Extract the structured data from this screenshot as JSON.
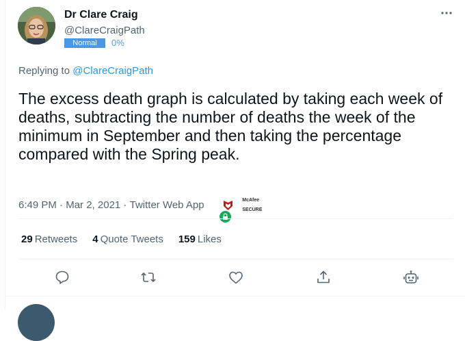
{
  "tweet": {
    "author_name": "Dr Clare Craig",
    "author_handle": "@ClareCraigPath",
    "badge_label": "Normal",
    "badge_percent": "0%",
    "replying_prefix": "Replying to ",
    "replying_to": "@ClareCraigPath",
    "text": "The excess death graph is calculated by taking each week of deaths, subtracting the number of deaths the week of the minimum in September and then taking the percentage compared with the Spring peak.",
    "time": "6:49 PM",
    "date": "Mar 2, 2021",
    "source": "Twitter Web App",
    "separator": " · ",
    "mcafee_line1": "McAfee",
    "mcafee_line2": "SECURE"
  },
  "stats": [
    {
      "count": "29",
      "label": "Retweets"
    },
    {
      "count": "4",
      "label": "Quote Tweets"
    },
    {
      "count": "159",
      "label": "Likes"
    }
  ],
  "colors": {
    "accent": "#1d9bf0",
    "text_primary": "#0f1419",
    "text_secondary": "#536471",
    "badge_bg": "#4b97e1",
    "lock_green": "#19a954",
    "mcafee_red": "#c01818"
  },
  "icons": [
    "more-icon",
    "lock-icon",
    "mcafee-shield-icon",
    "reply-icon",
    "retweet-icon",
    "like-icon",
    "share-icon",
    "bot-icon"
  ]
}
